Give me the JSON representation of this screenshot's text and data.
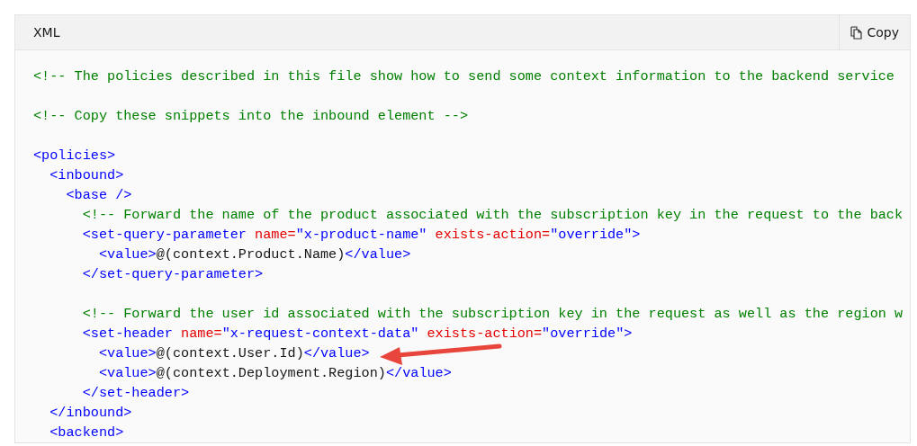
{
  "code_block": {
    "language": "XML",
    "copy_button": "Copy",
    "lines": [
      {
        "kind": "code",
        "tokens": [
          {
            "kind": "comment",
            "text": "<!-- The policies described in this file show how to send some context information to the backend service"
          }
        ]
      },
      {
        "kind": "blank"
      },
      {
        "kind": "code",
        "tokens": [
          {
            "kind": "comment",
            "text": "<!-- Copy these snippets into the inbound element -->"
          }
        ]
      },
      {
        "kind": "blank"
      },
      {
        "kind": "code",
        "tokens": [
          {
            "kind": "tag",
            "text": "<policies>"
          }
        ]
      },
      {
        "kind": "code",
        "tokens": [
          {
            "kind": "tag",
            "text": "  <inbound>"
          }
        ]
      },
      {
        "kind": "code",
        "tokens": [
          {
            "kind": "tag",
            "text": "    <base />"
          }
        ]
      },
      {
        "kind": "code",
        "tokens": [
          {
            "kind": "comment",
            "text": "      <!-- Forward the name of the product associated with the subscription key in the request to the back"
          }
        ]
      },
      {
        "kind": "code",
        "tokens": [
          {
            "kind": "tag",
            "text": "      <set-query-parameter"
          },
          {
            "kind": "attr",
            "text": " name="
          },
          {
            "kind": "value",
            "text": "\"x-product-name\""
          },
          {
            "kind": "attr",
            "text": " exists-action="
          },
          {
            "kind": "value",
            "text": "\"override\""
          },
          {
            "kind": "tag",
            "text": ">"
          }
        ]
      },
      {
        "kind": "code",
        "tokens": [
          {
            "kind": "tag",
            "text": "        <value>"
          },
          {
            "kind": "text",
            "text": "@(context.Product.Name)"
          },
          {
            "kind": "tag",
            "text": "</value>"
          }
        ]
      },
      {
        "kind": "code",
        "tokens": [
          {
            "kind": "tag",
            "text": "      </set-query-parameter>"
          }
        ]
      },
      {
        "kind": "blank"
      },
      {
        "kind": "code",
        "tokens": [
          {
            "kind": "comment",
            "text": "      <!-- Forward the user id associated with the subscription key in the request as well as the region w"
          }
        ]
      },
      {
        "kind": "code",
        "tokens": [
          {
            "kind": "tag",
            "text": "      <set-header"
          },
          {
            "kind": "attr",
            "text": " name="
          },
          {
            "kind": "value",
            "text": "\"x-request-context-data\""
          },
          {
            "kind": "attr",
            "text": " exists-action="
          },
          {
            "kind": "value",
            "text": "\"override\""
          },
          {
            "kind": "tag",
            "text": ">"
          }
        ]
      },
      {
        "kind": "code",
        "tokens": [
          {
            "kind": "tag",
            "text": "        <value>"
          },
          {
            "kind": "text",
            "text": "@(context.User.Id)"
          },
          {
            "kind": "tag",
            "text": "</value>"
          }
        ]
      },
      {
        "kind": "code",
        "tokens": [
          {
            "kind": "tag",
            "text": "        <value>"
          },
          {
            "kind": "text",
            "text": "@(context.Deployment.Region)"
          },
          {
            "kind": "tag",
            "text": "</value>"
          }
        ]
      },
      {
        "kind": "code",
        "tokens": [
          {
            "kind": "tag",
            "text": "      </set-header>"
          }
        ]
      },
      {
        "kind": "code",
        "tokens": [
          {
            "kind": "tag",
            "text": "  </inbound>"
          }
        ]
      },
      {
        "kind": "code",
        "tokens": [
          {
            "kind": "tag",
            "text": "  <backend>"
          }
        ]
      }
    ]
  }
}
